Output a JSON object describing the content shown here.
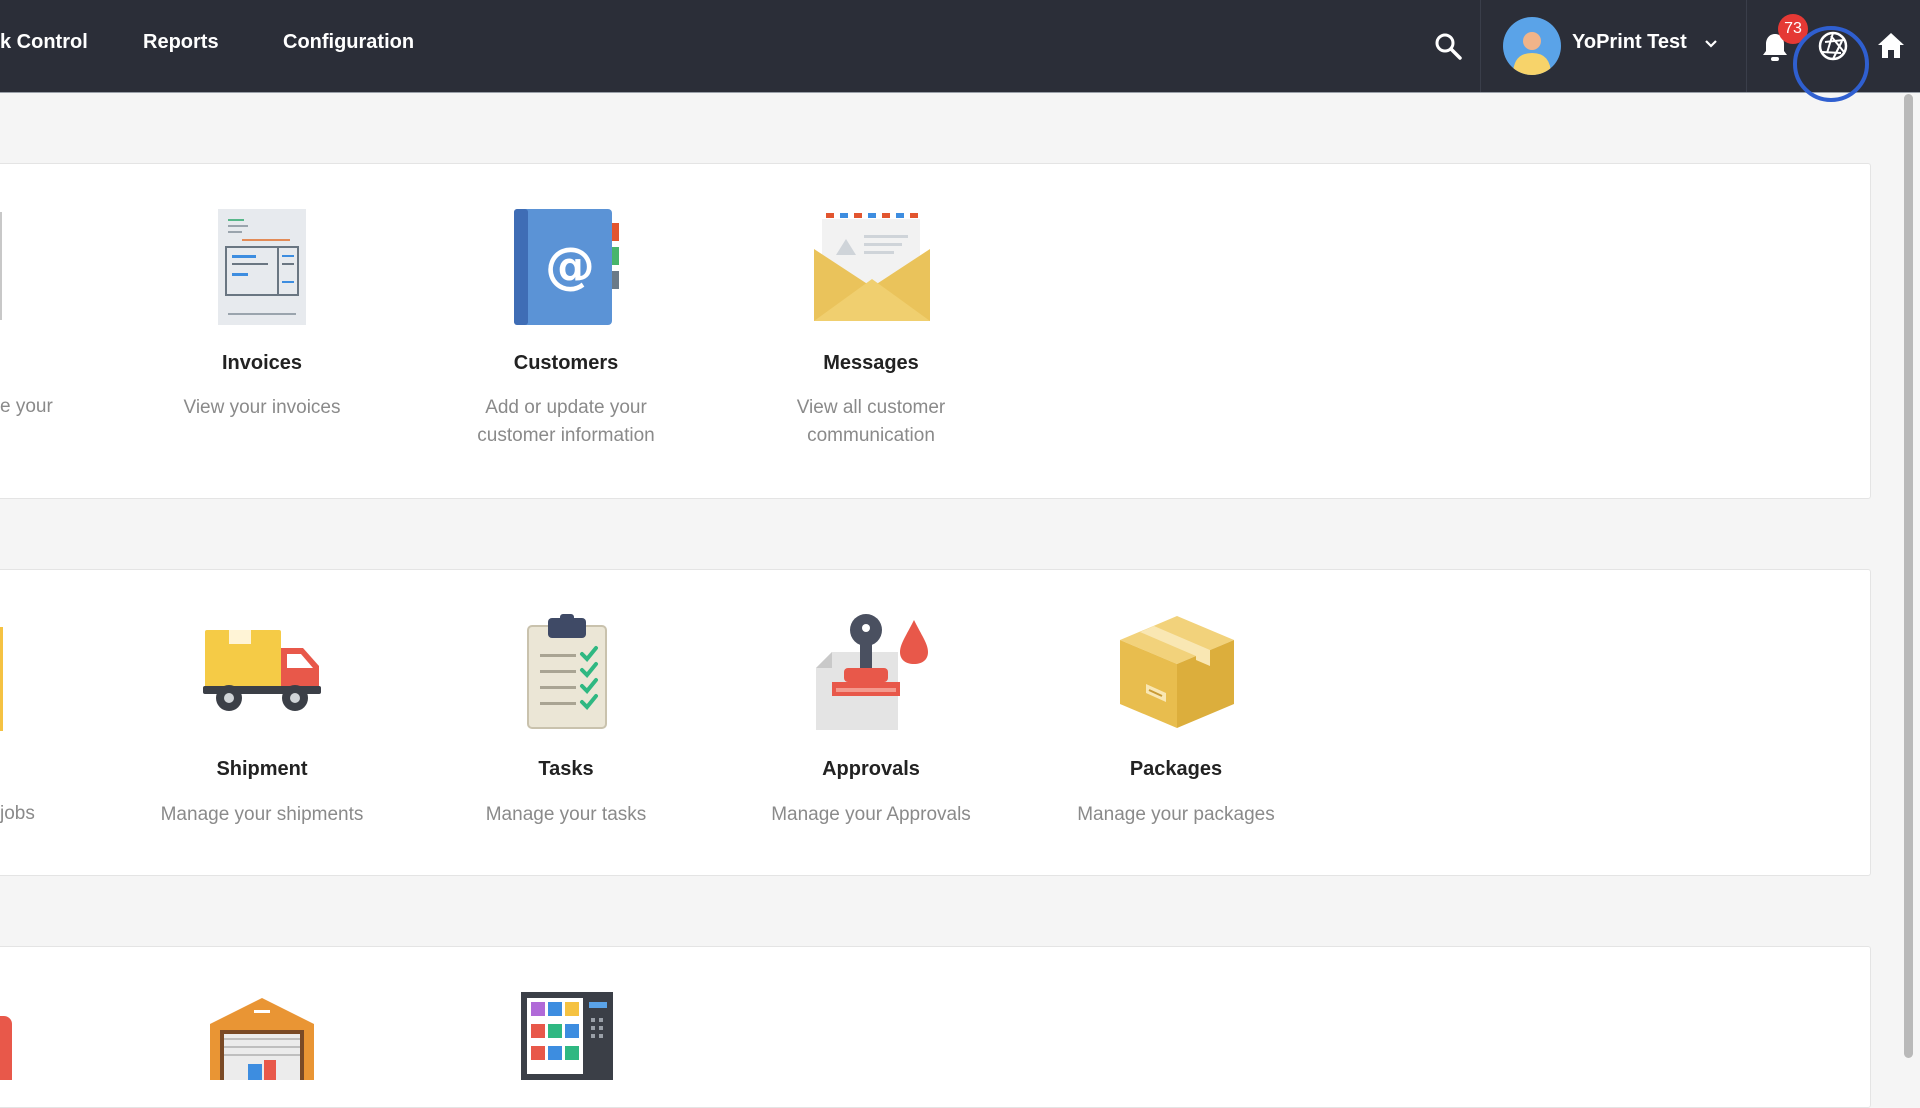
{
  "nav": {
    "items": [
      "k Control",
      "Reports",
      "Configuration"
    ],
    "user_name": "YoPrint Test",
    "notification_count": "73"
  },
  "partials": {
    "row1_desc": "e your",
    "row2_desc": "jobs"
  },
  "row1": [
    {
      "title": "Invoices",
      "desc1": "View your invoices",
      "desc2": ""
    },
    {
      "title": "Customers",
      "desc1": "Add or update your",
      "desc2": "customer information"
    },
    {
      "title": "Messages",
      "desc1": "View all customer",
      "desc2": "communication"
    }
  ],
  "row2": [
    {
      "title": "Shipment",
      "desc": "Manage your shipments"
    },
    {
      "title": "Tasks",
      "desc": "Manage your tasks"
    },
    {
      "title": "Approvals",
      "desc": "Manage your Approvals"
    },
    {
      "title": "Packages",
      "desc": "Manage your packages"
    }
  ],
  "colors": {
    "nav_bg": "#2b2e38",
    "badge": "#e53935",
    "focus": "#2f5fd0"
  }
}
